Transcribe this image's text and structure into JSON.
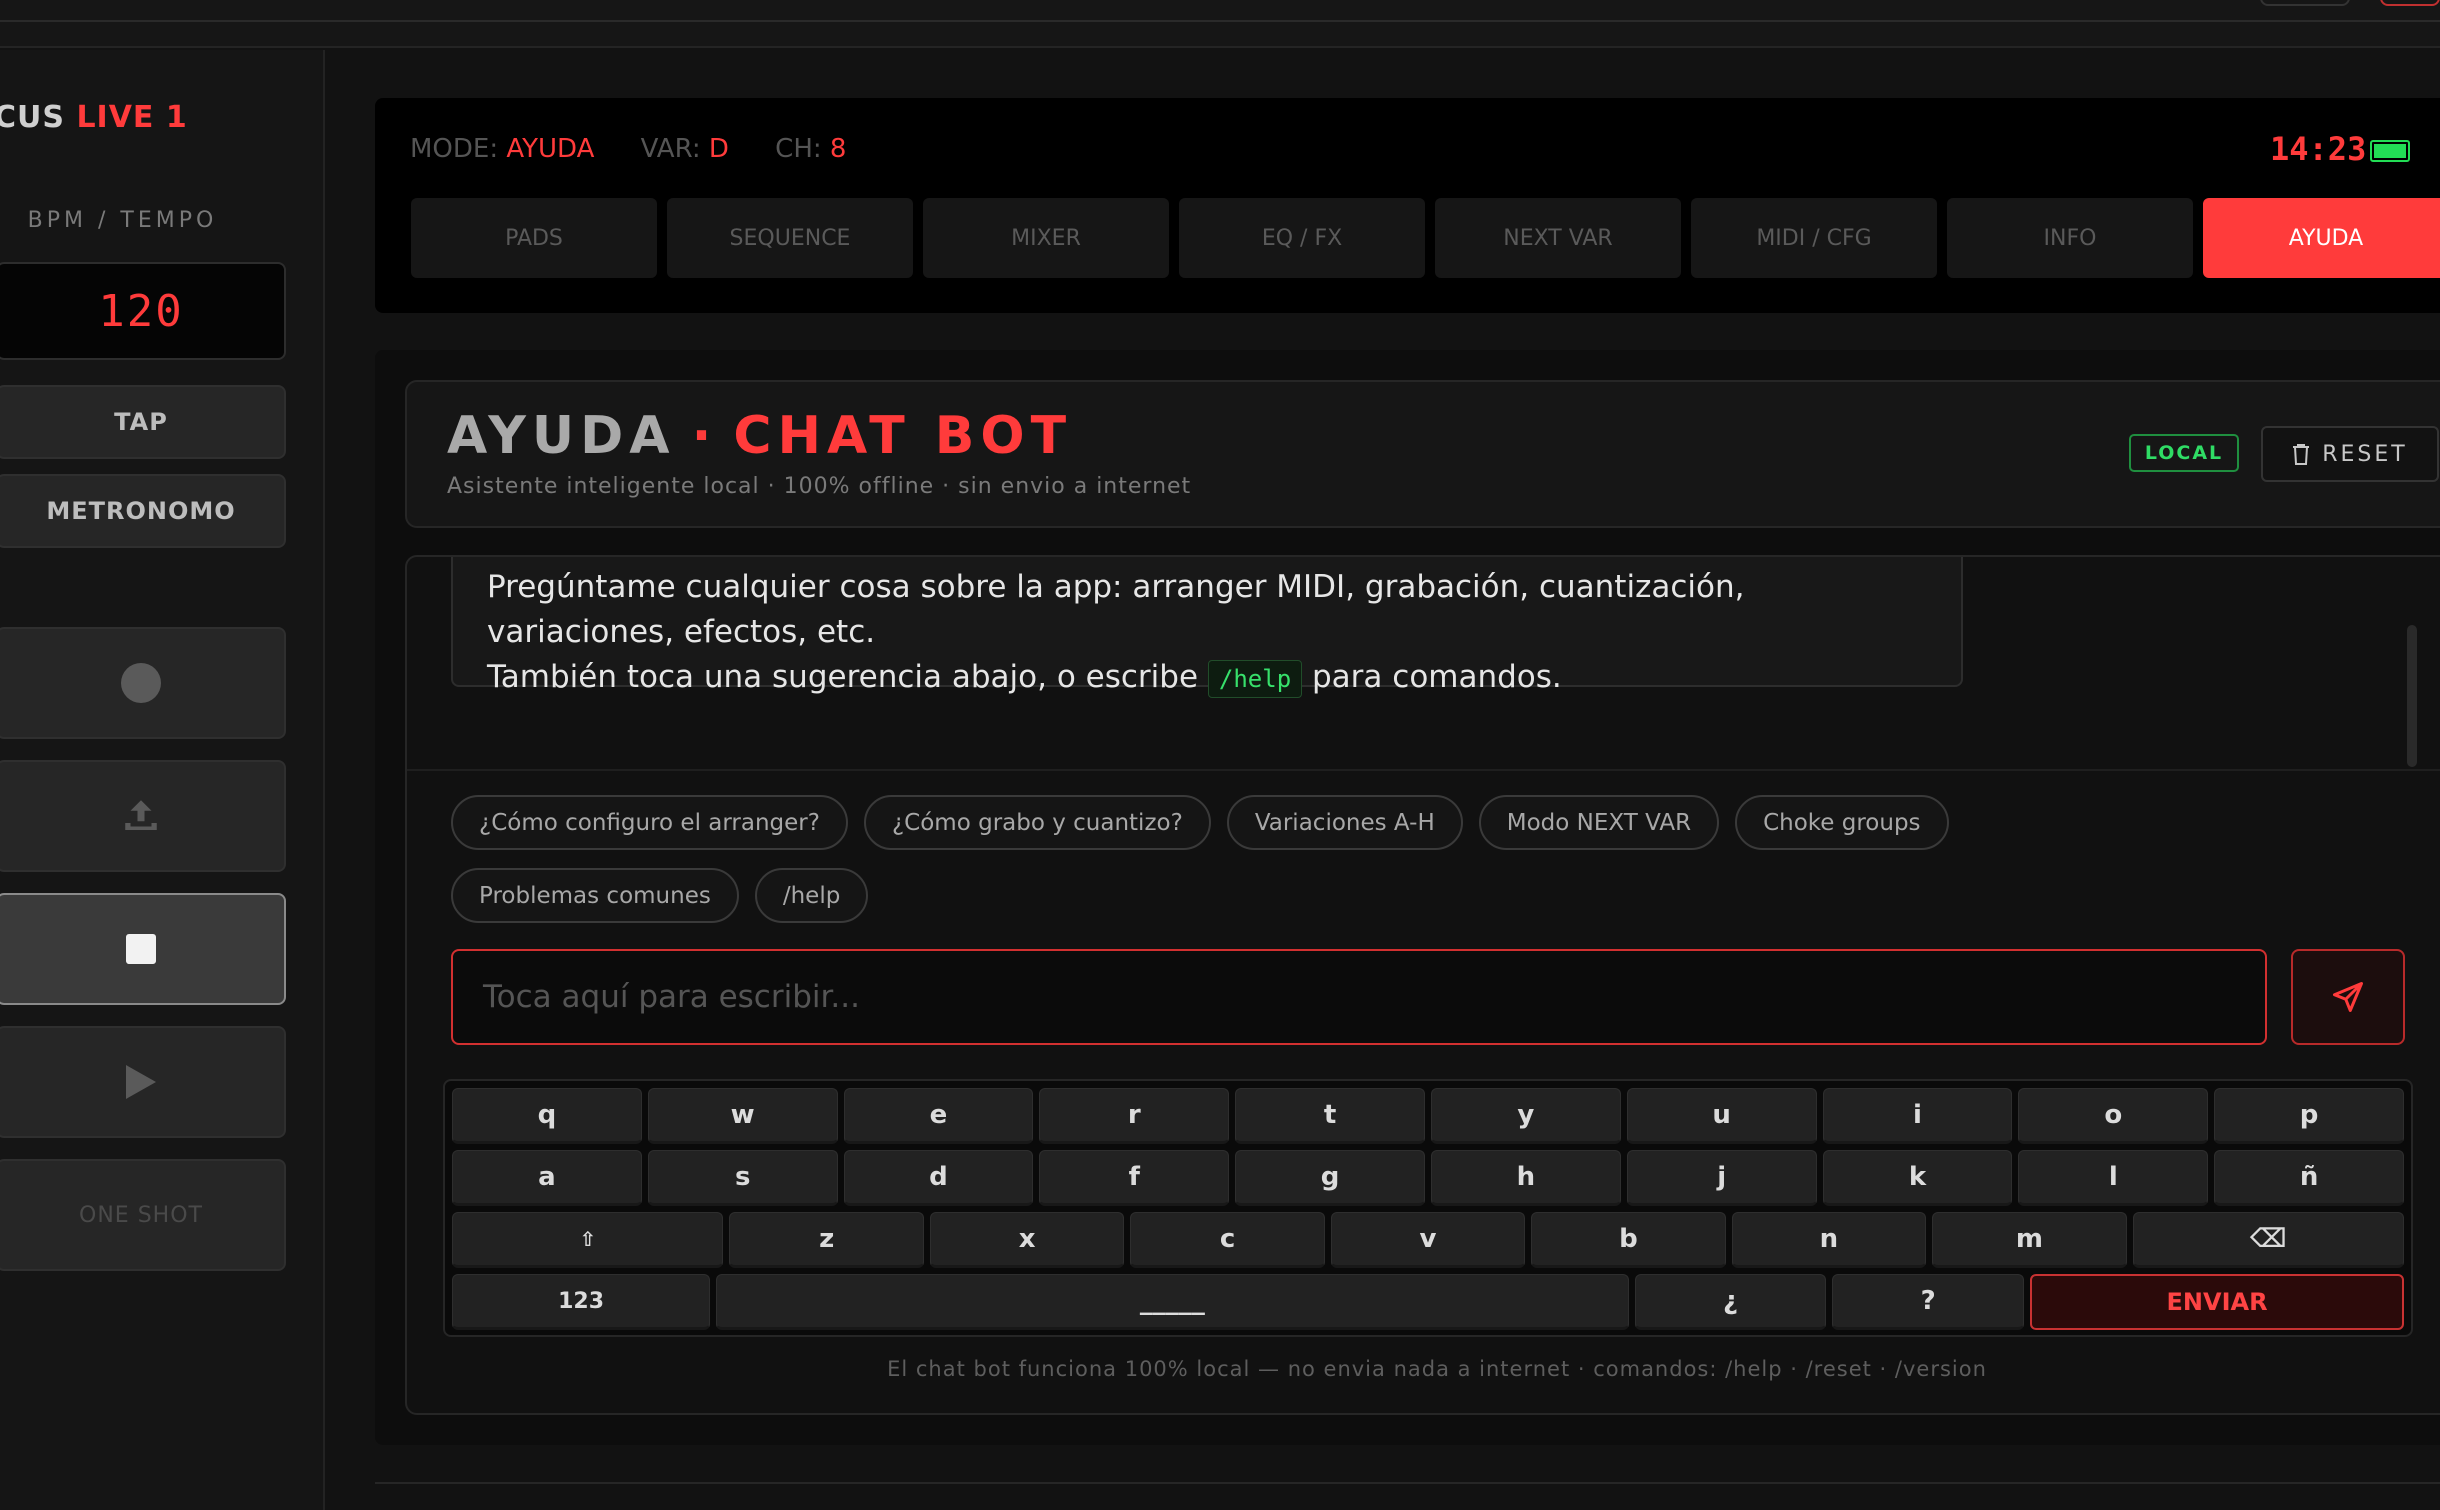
{
  "app": {
    "brand_prefix": "CUS",
    "brand_highlight": "LIVE 1"
  },
  "sidebar": {
    "bpm_label": "BPM / TEMPO",
    "bpm_value": "120",
    "tap_label": "TAP",
    "metronome_label": "METRONOMO",
    "one_shot_label": "ONE SHOT"
  },
  "status": {
    "mode_label": "MODE:",
    "mode_value": "AYUDA",
    "var_label": "VAR:",
    "var_value": "D",
    "ch_label": "CH:",
    "ch_value": "8",
    "clock": "14:23"
  },
  "tabs": [
    "PADS",
    "SEQUENCE",
    "MIXER",
    "EQ / FX",
    "NEXT VAR",
    "MIDI / CFG",
    "INFO",
    "AYUDA"
  ],
  "active_tab": "AYUDA",
  "header": {
    "title_main": "AYUDA",
    "title_sep": "·",
    "title_accent": "CHAT BOT",
    "subtitle": "Asistente inteligente local · 100% offline · sin envio a internet",
    "badge": "LOCAL",
    "reset_label": "RESET"
  },
  "message": {
    "line1": "Pregúntame cualquier cosa sobre la app: arranger MIDI, grabación, cuantización,",
    "line2": "variaciones, efectos, etc.",
    "line3_pre": "También toca una sugerencia abajo, o escribe",
    "line3_code": "/help",
    "line3_post": "para comandos."
  },
  "suggestions": [
    "¿Cómo configuro el arranger?",
    "¿Cómo grabo y cuantizo?",
    "Variaciones A-H",
    "Modo NEXT VAR",
    "Choke groups",
    "Problemas comunes",
    "/help"
  ],
  "input": {
    "placeholder": "Toca aquí para escribir..."
  },
  "keyboard": {
    "row1": [
      "q",
      "w",
      "e",
      "r",
      "t",
      "y",
      "u",
      "i",
      "o",
      "p"
    ],
    "row2": [
      "a",
      "s",
      "d",
      "f",
      "g",
      "h",
      "j",
      "k",
      "l",
      "ñ"
    ],
    "shift": "⇧",
    "row3": [
      "z",
      "x",
      "c",
      "v",
      "b",
      "n",
      "m"
    ],
    "backspace": "⌫",
    "numbers": "123",
    "space": "_____",
    "inv_question": "¿",
    "question": "?",
    "send": "ENVIAR"
  },
  "footnote": "El chat bot funciona 100% local — no envia nada a internet · comandos: /help · /reset · /version",
  "colors": {
    "accent": "#ff3b3b",
    "ok": "#2fdc65",
    "bg": "#121212"
  }
}
